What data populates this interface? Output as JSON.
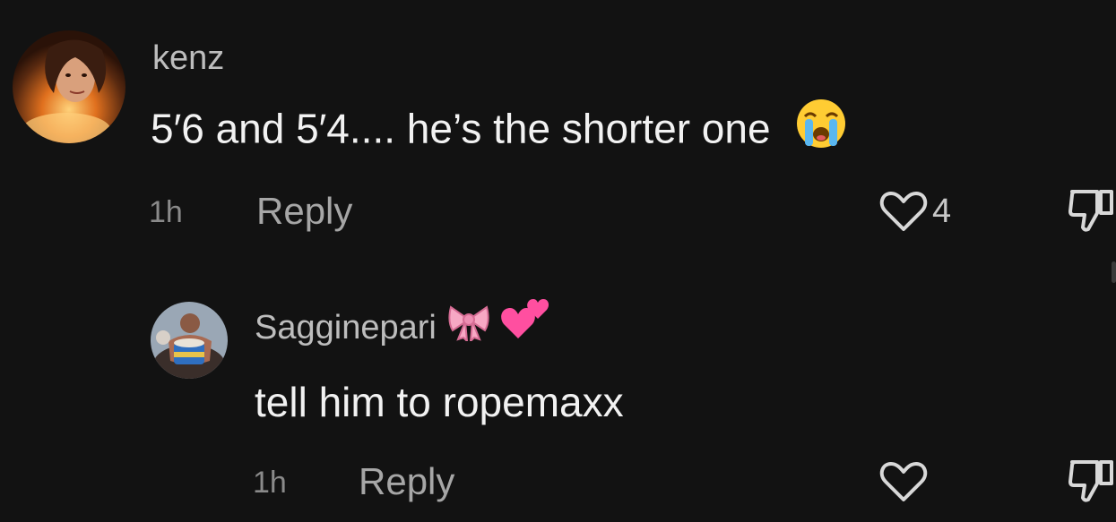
{
  "comments": [
    {
      "username": "kenz",
      "text": "5′6 and 5′4.... he’s the shorter one",
      "text_emoji": "loudly-crying-face-emoji",
      "time": "1h",
      "reply_label": "Reply",
      "like_count": "4",
      "like_icon": "heart-outline-icon",
      "dislike_icon": "thumbs-down-icon"
    },
    {
      "username": "Sagginepari",
      "username_emojis": [
        "ribbon-bow-emoji",
        "two-hearts-emoji"
      ],
      "text": "tell him to ropemaxx",
      "time": "1h",
      "reply_label": "Reply",
      "like_icon": "heart-outline-icon",
      "dislike_icon": "thumbs-down-icon"
    }
  ],
  "colors": {
    "background": "#121212",
    "text": "#f2f2f2",
    "secondary": "#a6a6a6",
    "muted": "#8a8a8a"
  }
}
